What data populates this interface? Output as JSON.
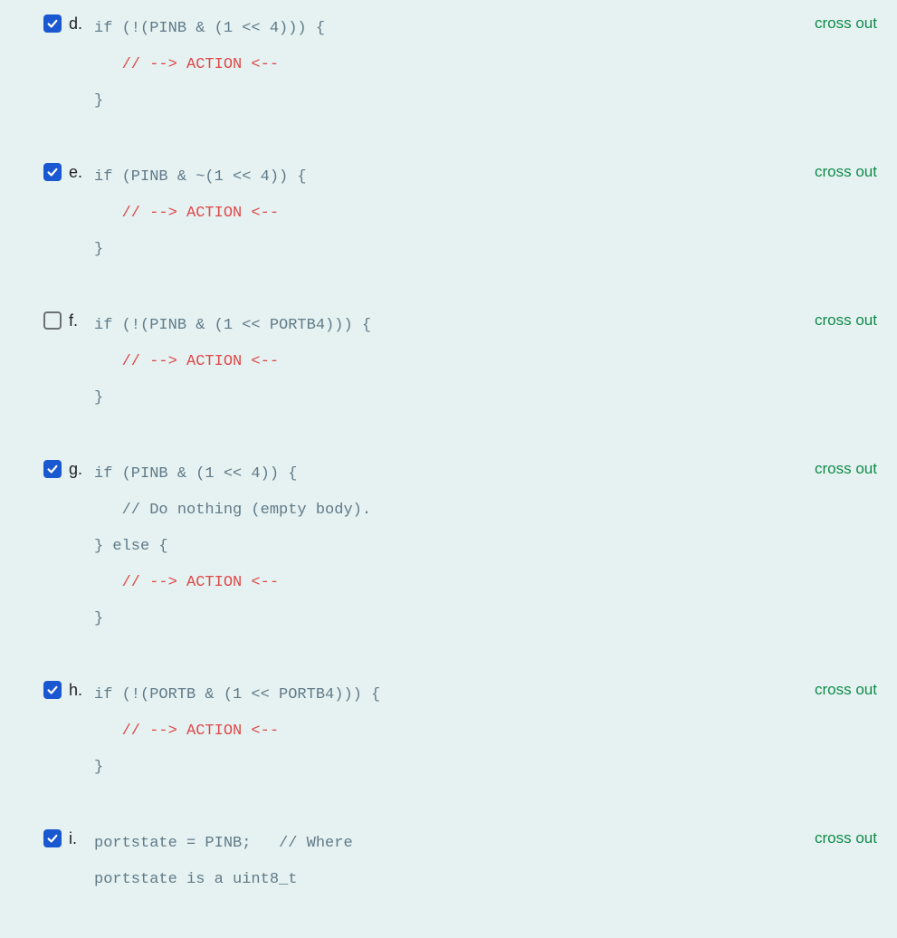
{
  "crossout_label": "cross out",
  "options": [
    {
      "letter": "d.",
      "checked": true,
      "code": [
        {
          "text": "if (!(PINB & (1 << 4))) {",
          "cls": ""
        },
        {
          "text": "   // --> ACTION <--",
          "cls": "action"
        },
        {
          "text": "}",
          "cls": ""
        }
      ]
    },
    {
      "letter": "e.",
      "checked": true,
      "code": [
        {
          "text": "if (PINB & ~(1 << 4)) {",
          "cls": ""
        },
        {
          "text": "   // --> ACTION <--",
          "cls": "action"
        },
        {
          "text": "}",
          "cls": ""
        }
      ]
    },
    {
      "letter": "f.",
      "checked": false,
      "code": [
        {
          "text": "if (!(PINB & (1 << PORTB4))) {",
          "cls": ""
        },
        {
          "text": "   // --> ACTION <--",
          "cls": "action"
        },
        {
          "text": "}",
          "cls": ""
        }
      ]
    },
    {
      "letter": "g.",
      "checked": true,
      "code": [
        {
          "text": "if (PINB & (1 << 4)) {",
          "cls": ""
        },
        {
          "text": "   // Do nothing (empty body).",
          "cls": "comment"
        },
        {
          "text": "} else {",
          "cls": ""
        },
        {
          "text": "   // --> ACTION <--",
          "cls": "action"
        },
        {
          "text": "}",
          "cls": ""
        }
      ]
    },
    {
      "letter": "h.",
      "checked": true,
      "code": [
        {
          "text": "if (!(PORTB & (1 << PORTB4))) {",
          "cls": ""
        },
        {
          "text": "   // --> ACTION <--",
          "cls": "action"
        },
        {
          "text": "}",
          "cls": ""
        }
      ]
    },
    {
      "letter": "i.",
      "checked": true,
      "code": [
        {
          "text": "portstate = PINB;   // Where",
          "cls": ""
        },
        {
          "text": "portstate is a uint8_t",
          "cls": ""
        }
      ]
    }
  ]
}
